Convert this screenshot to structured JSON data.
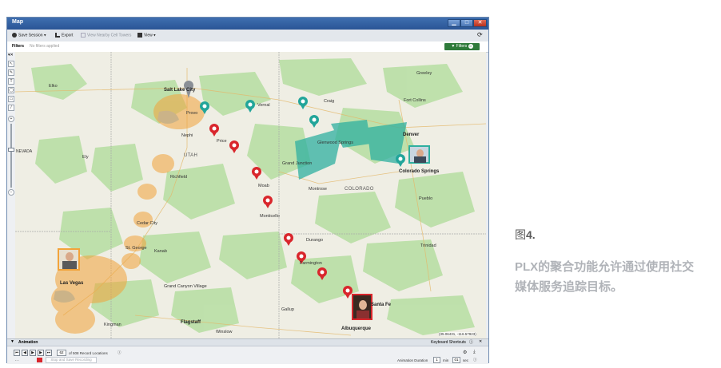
{
  "window": {
    "title": "Map",
    "min_label": "▁",
    "max_label": "□",
    "close_label": "✕"
  },
  "toolbar": {
    "save_session": "Save Session ▾",
    "export": "Export",
    "view_nearby": "View Nearby Cell Towers",
    "view": "View ▾"
  },
  "filterbar": {
    "label": "Filters",
    "status": "No filters applied",
    "button": "Filters",
    "count": "0"
  },
  "map_labels": {
    "elko": "Elko",
    "salt_lake_city": "Salt Lake City",
    "provo": "Provo",
    "vernal": "Vernal",
    "craig": "Craig",
    "fort_collins": "Fort Collins",
    "greeley": "Greeley",
    "nephi": "Nephi",
    "price": "Price",
    "utah": "UTAH",
    "ely": "Ely",
    "richfield": "Richfield",
    "glenwood_springs": "Glenwood Springs",
    "denver": "Denver",
    "colorado_springs": "Colorado Springs",
    "grand_junction": "Grand Junction",
    "moab": "Moab",
    "montrose": "Montrose",
    "colorado": "COLORADO",
    "pueblo": "Pueblo",
    "cedar_city": "Cedar City",
    "monticello": "Monticello",
    "st_george": "St. George",
    "kanab": "Kanab",
    "durango": "Durango",
    "trinidad": "Trinidad",
    "las_vegas": "Las Vegas",
    "farmington": "Farmington",
    "grand_canyon": "Grand Canyon Village",
    "gallup": "Gallup",
    "santa_fe": "Santa Fe",
    "flagstaff": "Flagstaff",
    "winslow": "Winslow",
    "kingman": "Kingman",
    "albuquerque": "Albuquerque",
    "coords": "(35.06431, -116.57923)",
    "nevada_short": "NEVADA"
  },
  "animation": {
    "title": "Animation",
    "shortcuts": "Keyboard Shortcuts",
    "current": "62",
    "record_text": "of 508 Record Locations",
    "dashes": "- -",
    "stop_save": "Stop and Save Recording",
    "duration_label": "Animation Duration",
    "minutes": "1",
    "min_unit": "min",
    "seconds": "01",
    "sec_unit": "sec"
  },
  "caption": {
    "fig_prefix": "图",
    "fig_number": "4.",
    "text": "PLX的聚合功能允许通过使用社交媒体服务追踪目标。"
  },
  "colors": {
    "title_bar": "#2f5f9f",
    "filters_button": "#2e7a3a",
    "pin_red": "#d9262c",
    "pin_teal": "#22a59a",
    "heat_orange": "#f2a33a",
    "heat_teal": "#2fb0a0"
  }
}
